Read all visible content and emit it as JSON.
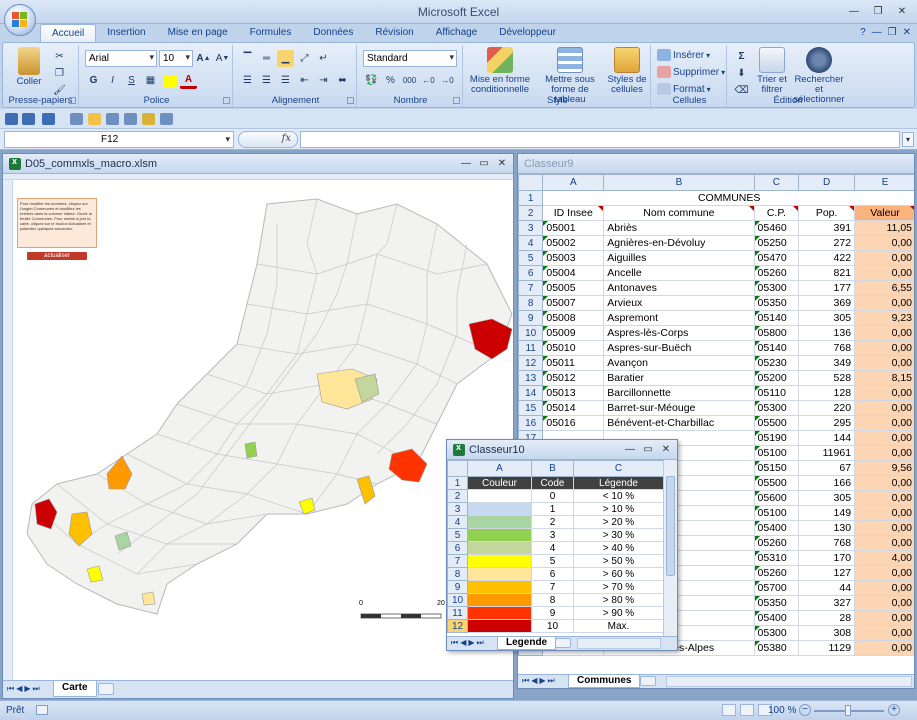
{
  "app": {
    "title": "Microsoft Excel"
  },
  "ribbon": {
    "tabs": [
      "Accueil",
      "Insertion",
      "Mise en page",
      "Formules",
      "Données",
      "Révision",
      "Affichage",
      "Développeur"
    ],
    "clipboard": {
      "paste": "Coller",
      "label": "Presse-papiers"
    },
    "font": {
      "name": "Arial",
      "size": "10",
      "label": "Police"
    },
    "alignment": {
      "label": "Alignement"
    },
    "number": {
      "format": "Standard",
      "label": "Nombre",
      "percent": "%",
      "thousands": "000"
    },
    "style": {
      "conditional": "Mise en forme conditionnelle",
      "table": "Mettre sous forme de tableau",
      "cell_styles": "Styles de cellules",
      "label": "Style"
    },
    "cells": {
      "insert": "Insérer",
      "delete": "Supprimer",
      "format": "Format",
      "label": "Cellules"
    },
    "editing": {
      "sum": "Σ",
      "sort": "Trier et filtrer",
      "find": "Rechercher et sélectionner",
      "label": "Édition"
    }
  },
  "formula_bar": {
    "cell_ref": "F12",
    "fx": "fx"
  },
  "carte_window": {
    "title": "D05_commxls_macro.xlsm",
    "sheet_tab": "Carte",
    "info_text": "Pour modifier les données, cliquez sur l'onglet Communes et modifiez les entrées dans la colonne Valeur. Ouvrir la feuille Communes. Pour mettre à jour la carte, cliquez sur le bouton Actualiser et patientez quelques secondes.",
    "refresh_label": "actualiser",
    "scale_start": "0",
    "scale_end": "20"
  },
  "classeur9": {
    "title": "Classeur9",
    "sheet_tab": "Communes",
    "columns": [
      "A",
      "B",
      "C",
      "D",
      "E"
    ],
    "header_title": "COMMUNES",
    "headers": [
      "ID Insee",
      "Nom commune",
      "C.P.",
      "Pop.",
      "Valeur"
    ],
    "rows": [
      {
        "n": "3",
        "id": "05001",
        "name": "Abriès",
        "cp": "05460",
        "pop": "391",
        "val": "11,05"
      },
      {
        "n": "4",
        "id": "05002",
        "name": "Agnières-en-Dévoluy",
        "cp": "05250",
        "pop": "272",
        "val": "0,00"
      },
      {
        "n": "5",
        "id": "05003",
        "name": "Aiguilles",
        "cp": "05470",
        "pop": "422",
        "val": "0,00"
      },
      {
        "n": "6",
        "id": "05004",
        "name": "Ancelle",
        "cp": "05260",
        "pop": "821",
        "val": "0,00"
      },
      {
        "n": "7",
        "id": "05005",
        "name": "Antonaves",
        "cp": "05300",
        "pop": "177",
        "val": "6,55"
      },
      {
        "n": "8",
        "id": "05007",
        "name": "Arvieux",
        "cp": "05350",
        "pop": "369",
        "val": "0,00"
      },
      {
        "n": "9",
        "id": "05008",
        "name": "Aspremont",
        "cp": "05140",
        "pop": "305",
        "val": "9,23"
      },
      {
        "n": "10",
        "id": "05009",
        "name": "Aspres-lès-Corps",
        "cp": "05800",
        "pop": "136",
        "val": "0,00"
      },
      {
        "n": "11",
        "id": "05010",
        "name": "Aspres-sur-Buëch",
        "cp": "05140",
        "pop": "768",
        "val": "0,00"
      },
      {
        "n": "12",
        "id": "05011",
        "name": "Avançon",
        "cp": "05230",
        "pop": "349",
        "val": "0,00"
      },
      {
        "n": "13",
        "id": "05012",
        "name": "Baratier",
        "cp": "05200",
        "pop": "528",
        "val": "8,15"
      },
      {
        "n": "14",
        "id": "05013",
        "name": "Barcillonnette",
        "cp": "05110",
        "pop": "128",
        "val": "0,00"
      },
      {
        "n": "15",
        "id": "05014",
        "name": "Barret-sur-Méouge",
        "cp": "05300",
        "pop": "220",
        "val": "0,00"
      },
      {
        "n": "16",
        "id": "05016",
        "name": "Bénévent-et-Charbillac",
        "cp": "05500",
        "pop": "295",
        "val": "0,00"
      },
      {
        "n": "17",
        "id": "",
        "name": "",
        "cp": "05190",
        "pop": "144",
        "val": "0,00"
      },
      {
        "n": "18",
        "id": "",
        "name": "",
        "cp": "05100",
        "pop": "11961",
        "val": "0,00"
      },
      {
        "n": "19",
        "id": "",
        "name": "",
        "cp": "05150",
        "pop": "67",
        "val": "9,56"
      },
      {
        "n": "20",
        "id": "",
        "name": "",
        "cp": "05500",
        "pop": "166",
        "val": "0,00"
      },
      {
        "n": "21",
        "id": "",
        "name": "",
        "cp": "05600",
        "pop": "305",
        "val": "0,00"
      },
      {
        "n": "22",
        "id": "",
        "name": "",
        "cp": "05100",
        "pop": "149",
        "val": "0,00"
      },
      {
        "n": "23",
        "id": "",
        "name": "",
        "cp": "05400",
        "pop": "130",
        "val": "0,00"
      },
      {
        "n": "24",
        "id": "",
        "name": "",
        "cp": "05260",
        "pop": "768",
        "val": "0,00"
      },
      {
        "n": "25",
        "id": "",
        "name": "",
        "cp": "05310",
        "pop": "170",
        "val": "4,00"
      },
      {
        "n": "26",
        "id": "",
        "name": "",
        "cp": "05260",
        "pop": "127",
        "val": "0,00"
      },
      {
        "n": "27",
        "id": "",
        "name": "",
        "cp": "05700",
        "pop": "44",
        "val": "0,00"
      },
      {
        "n": "28",
        "id": "",
        "name": "ieille",
        "cp": "05350",
        "pop": "327",
        "val": "0,00"
      },
      {
        "n": "29",
        "id": "",
        "name": "Oze",
        "cp": "05400",
        "pop": "28",
        "val": "0,00"
      },
      {
        "n": "30",
        "id": "",
        "name": "-Chabre",
        "cp": "05300",
        "pop": "308",
        "val": "0,00"
      },
      {
        "n": "31",
        "id": "05036",
        "name": "Châteauroux-les-Alpes",
        "cp": "05380",
        "pop": "1129",
        "val": "0,00"
      }
    ]
  },
  "classeur10": {
    "title": "Classeur10",
    "sheet_tab": "Legende",
    "columns": [
      "A",
      "B",
      "C"
    ],
    "headers": [
      "Couleur",
      "Code",
      "Légende"
    ],
    "rows": [
      {
        "n": "2",
        "color": "#ffffff",
        "code": "0",
        "legend": "< 10 %"
      },
      {
        "n": "3",
        "color": "#c6d9f1",
        "code": "1",
        "legend": "> 10 %"
      },
      {
        "n": "4",
        "color": "#a9d5a4",
        "code": "2",
        "legend": "> 20 %"
      },
      {
        "n": "5",
        "color": "#92d050",
        "code": "3",
        "legend": "> 30 %"
      },
      {
        "n": "6",
        "color": "#c3d69b",
        "code": "4",
        "legend": "> 40 %"
      },
      {
        "n": "7",
        "color": "#ffff00",
        "code": "5",
        "legend": "> 50 %"
      },
      {
        "n": "8",
        "color": "#ffe699",
        "code": "6",
        "legend": "> 60 %"
      },
      {
        "n": "9",
        "color": "#ffc000",
        "code": "7",
        "legend": "> 70 %"
      },
      {
        "n": "10",
        "color": "#ff9900",
        "code": "8",
        "legend": "> 80 %"
      },
      {
        "n": "11",
        "color": "#ff3300",
        "code": "9",
        "legend": "> 90 %"
      },
      {
        "n": "12",
        "color": "#cc0000",
        "code": "10",
        "legend": "Max."
      }
    ]
  },
  "status_bar": {
    "ready": "Prêt",
    "zoom": "100 %"
  }
}
